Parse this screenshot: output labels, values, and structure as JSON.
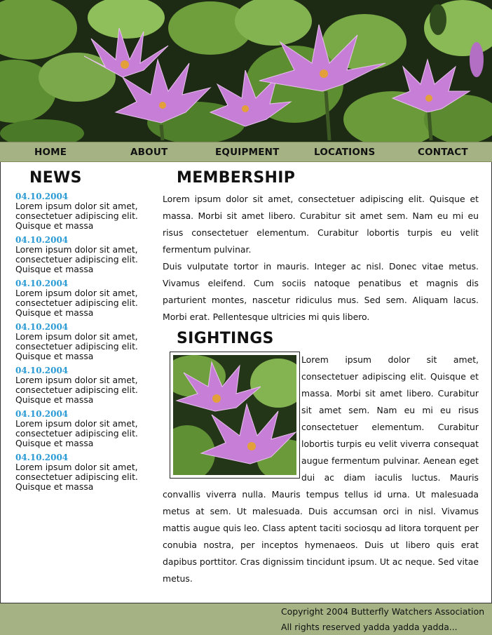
{
  "nav": {
    "items": [
      {
        "label": "HOME"
      },
      {
        "label": "ABOUT"
      },
      {
        "label": "EQUIPMENT"
      },
      {
        "label": "LOCATIONS"
      },
      {
        "label": "CONTACT"
      }
    ]
  },
  "news": {
    "title": "NEWS",
    "items": [
      {
        "date": "04.10.2004",
        "text": "Lorem ipsum dolor sit amet, consectetuer adipiscing elit. Quisque et massa"
      },
      {
        "date": "04.10.2004",
        "text": "Lorem ipsum dolor sit amet, consectetuer adipiscing elit. Quisque et massa"
      },
      {
        "date": "04.10.2004",
        "text": "Lorem ipsum dolor sit amet, consectetuer adipiscing elit. Quisque et massa"
      },
      {
        "date": "04.10.2004",
        "text": "Lorem ipsum dolor sit amet, consectetuer adipiscing elit. Quisque et massa"
      },
      {
        "date": "04.10.2004",
        "text": "Lorem ipsum dolor sit amet, consectetuer adipiscing elit. Quisque et massa"
      },
      {
        "date": "04.10.2004",
        "text": "Lorem ipsum dolor sit amet, consectetuer adipiscing elit. Quisque et massa"
      },
      {
        "date": "04.10.2004",
        "text": "Lorem ipsum dolor sit amet, consectetuer adipiscing elit. Quisque et massa"
      }
    ]
  },
  "membership": {
    "title": "MEMBERSHIP",
    "p1": "Lorem ipsum dolor sit amet, consectetuer adipiscing elit. Quisque et massa. Morbi sit amet libero. Curabitur sit amet sem. Nam eu mi eu risus consectetuer elementum. Curabitur lobortis turpis eu velit fermentum pulvinar.",
    "p2": "Duis vulputate tortor in mauris. Integer ac nisl. Donec vitae metus. Vivamus eleifend. Cum sociis natoque penatibus et magnis dis parturient montes, nascetur ridiculus mus. Sed sem. Aliquam lacus. Morbi erat. Pellentesque ultricies mi quis libero."
  },
  "sightings": {
    "title": "SIGHTINGS",
    "text": "Lorem ipsum dolor sit amet, consectetuer adipiscing elit. Quisque et massa. Morbi sit amet libero. Curabitur sit amet sem. Nam eu mi eu risus consectetuer elementum. Curabitur lobortis turpis eu velit viverra consequat augue fermentum pulvinar. Aenean eget dui ac diam iaculis luctus. Mauris convallis viverra nulla. Mauris tempus tellus id urna. Ut malesuada metus at sem. Ut malesuada. Duis accumsan orci in nisl. Vivamus mattis augue quis leo. Class aptent taciti sociosqu ad litora torquent per conubia nostra, per inceptos hymenaeos. Duis ut libero quis erat dapibus porttitor. Cras dignissim tincidunt ipsum. Ut ac neque. Sed vitae metus."
  },
  "footer": {
    "copyright": "Copyright 2004 Butterfly Watchers Association",
    "rights": "All rights reserved yadda yadda yadda..."
  },
  "colors": {
    "nav_bg": "#a4b284",
    "date": "#2a9ad4"
  }
}
